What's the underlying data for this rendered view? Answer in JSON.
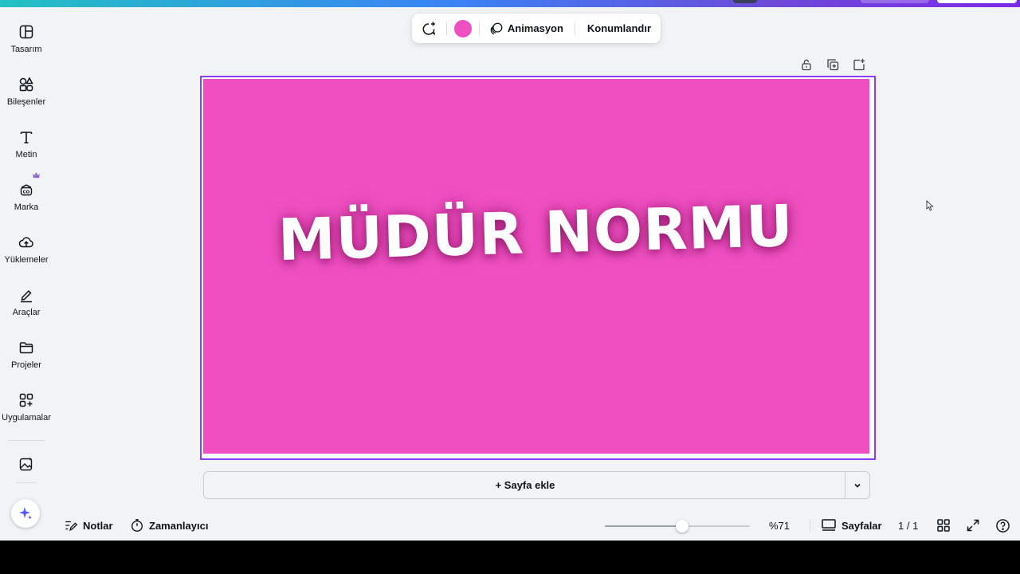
{
  "sidebar": {
    "items": [
      {
        "label": "Tasarım",
        "icon": "design-icon"
      },
      {
        "label": "Bileşenler",
        "icon": "elements-icon"
      },
      {
        "label": "Metin",
        "icon": "text-icon"
      },
      {
        "label": "Marka",
        "icon": "brand-icon"
      },
      {
        "label": "Yüklemeler",
        "icon": "upload-icon"
      },
      {
        "label": "Araçlar",
        "icon": "draw-icon"
      },
      {
        "label": "Projeler",
        "icon": "folder-icon"
      },
      {
        "label": "Uygulamalar",
        "icon": "apps-icon"
      }
    ]
  },
  "toolbar": {
    "color": "#f04fc2",
    "animate_label": "Animasyon",
    "position_label": "Konumlandır"
  },
  "canvas": {
    "background": "#f04fc2",
    "title": "MÜDÜR NORMU"
  },
  "add_page": {
    "label": "+ Sayfa ekle"
  },
  "bottom_bar": {
    "notes_label": "Notlar",
    "timer_label": "Zamanlayıcı",
    "zoom": 71,
    "zoom_text": "%71",
    "pages_label": "Sayfalar",
    "page_count": "1 / 1"
  }
}
